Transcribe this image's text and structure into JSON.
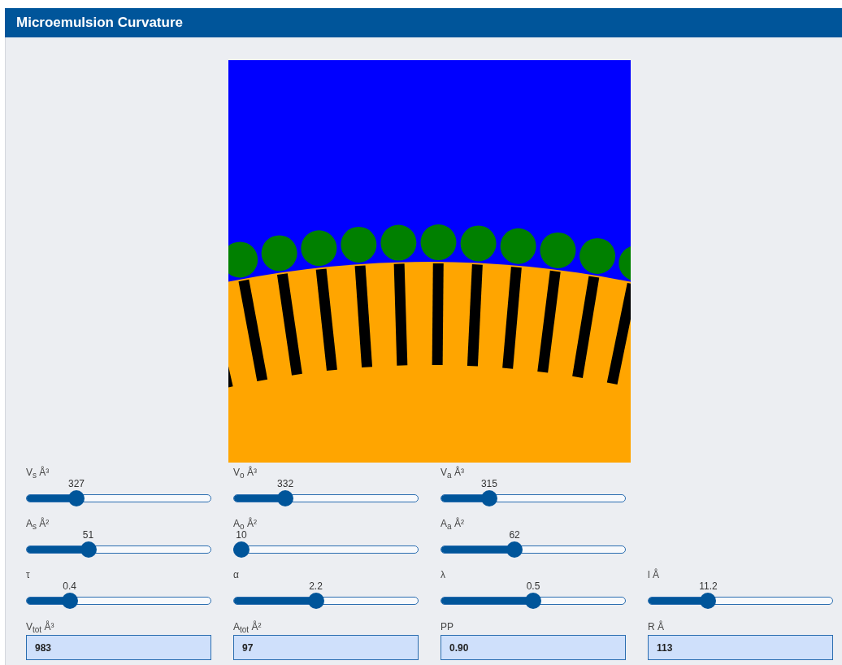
{
  "window": {
    "title": "Microemulsion Curvature"
  },
  "slider_rows": [
    {
      "sliders": [
        {
          "label": "V$_{s}$ Å³",
          "value": "327",
          "level": 0.25
        },
        {
          "label": "V$_{o}$ Å³",
          "value": "332",
          "level": 0.26
        },
        {
          "label": "V$_{a}$ Å³",
          "value": "315",
          "level": 0.24
        }
      ]
    },
    {
      "sliders": [
        {
          "label": "A$_{s}$ Å²",
          "value": "51",
          "level": 0.32
        },
        {
          "label": "A$_{o}$ Å²",
          "value": "10",
          "level": 0
        },
        {
          "label": "A$_{a}$ Å²",
          "value": "62",
          "level": 0.39
        }
      ]
    },
    {
      "sliders": [
        {
          "label": "τ",
          "value": "0.4",
          "level": 0.21
        },
        {
          "label": "α",
          "value": "2.2",
          "level": 0.44
        },
        {
          "label": "λ",
          "value": "0.5",
          "level": 0.5
        },
        {
          "label": "l Å",
          "value": "11.2",
          "level": 0.31
        }
      ]
    }
  ],
  "outputs": [
    {
      "label": "V$_{tot}$ Å³",
      "value": "983"
    },
    {
      "label": "A$_{tot}$ Å²",
      "value": "97"
    },
    {
      "label": "PP",
      "value": "0.90"
    },
    {
      "label": "R Å",
      "value": "113"
    }
  ]
}
